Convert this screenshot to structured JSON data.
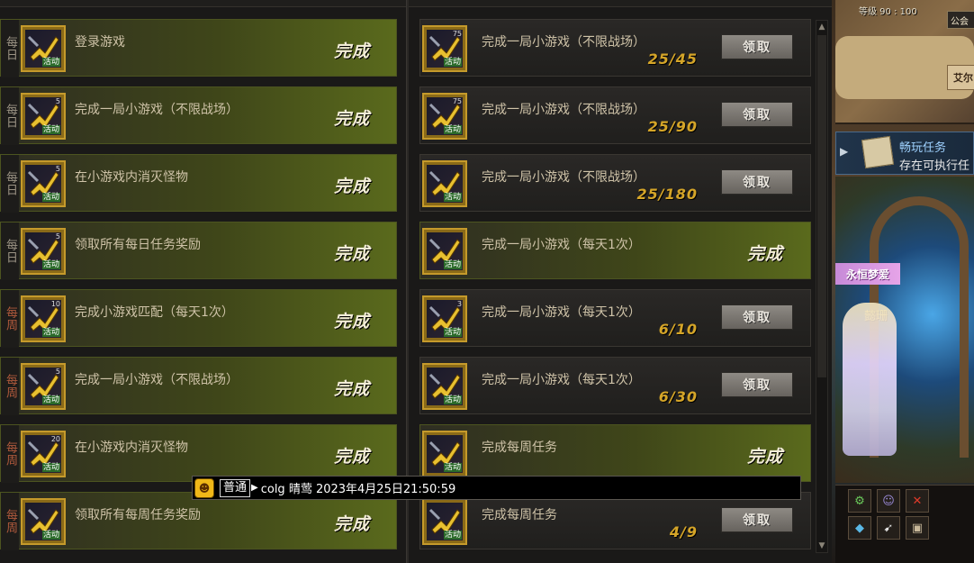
{
  "left_rows": [
    {
      "tag": "每日",
      "tag_type": "daily",
      "title": "登录游戏",
      "status": "完成",
      "icon_count": "",
      "icon_label": "活动"
    },
    {
      "tag": "每日",
      "tag_type": "daily",
      "title": "完成一局小游戏（不限战场）",
      "status": "完成",
      "icon_count": "5",
      "icon_label": "活动"
    },
    {
      "tag": "每日",
      "tag_type": "daily",
      "title": "在小游戏内消灭怪物",
      "status": "完成",
      "icon_count": "5",
      "icon_label": "活动"
    },
    {
      "tag": "每日",
      "tag_type": "daily",
      "title": "领取所有每日任务奖励",
      "status": "完成",
      "icon_count": "5",
      "icon_label": "活动"
    },
    {
      "tag": "每周",
      "tag_type": "weekly",
      "title": "完成小游戏匹配（每天1次）",
      "status": "完成",
      "icon_count": "10",
      "icon_label": "活动"
    },
    {
      "tag": "每周",
      "tag_type": "weekly",
      "title": "完成一局小游戏（不限战场）",
      "status": "完成",
      "icon_count": "5",
      "icon_label": "活动"
    },
    {
      "tag": "每周",
      "tag_type": "weekly",
      "title": "在小游戏内消灭怪物",
      "status": "完成",
      "icon_count": "20",
      "icon_label": "活动"
    },
    {
      "tag": "每周",
      "tag_type": "weekly",
      "title": "领取所有每周任务奖励",
      "status": "完成",
      "icon_count": "",
      "icon_label": "活动"
    }
  ],
  "right_rows": [
    {
      "title": "完成一局小游戏（不限战场）",
      "state": "claim",
      "progress": "25/45",
      "button": "领取",
      "icon_count": "75",
      "icon_label": "活动"
    },
    {
      "title": "完成一局小游戏（不限战场）",
      "state": "claim",
      "progress": "25/90",
      "button": "领取",
      "icon_count": "75",
      "icon_label": "活动"
    },
    {
      "title": "完成一局小游戏（不限战场）",
      "state": "claim",
      "progress": "25/180",
      "button": "领取",
      "icon_count": "",
      "icon_label": "活动"
    },
    {
      "title": "完成一局小游戏（每天1次）",
      "state": "done",
      "status": "完成",
      "icon_count": "",
      "icon_label": "活动"
    },
    {
      "title": "完成一局小游戏（每天1次）",
      "state": "claim",
      "progress": "6/10",
      "button": "领取",
      "icon_count": "3",
      "icon_label": "活动"
    },
    {
      "title": "完成一局小游戏（每天1次）",
      "state": "claim",
      "progress": "6/30",
      "button": "领取",
      "icon_count": "",
      "icon_label": "活动"
    },
    {
      "title": "完成每周任务",
      "state": "done",
      "status": "完成",
      "icon_count": "",
      "icon_label": "活动"
    },
    {
      "title": "完成每周任务",
      "state": "claim",
      "progress": "4/9",
      "button": "领取",
      "icon_count": "",
      "icon_label": "活动"
    }
  ],
  "chat": {
    "channel": "普通",
    "message": "colg 晴莺  2023年4月25日21:50:59"
  },
  "game_hud": {
    "level_text": "等级 90 : 100",
    "guild_button": "公会",
    "town_label": "艾尔",
    "quest_title": "畅玩任务",
    "quest_subtitle": "存在可执行任",
    "character_banner": "永恒梦爱",
    "character_name": "懿珊",
    "skill_icons": [
      "gear-icon",
      "cross-icon"
    ]
  },
  "colors": {
    "done_accent": "#5a6a1c",
    "progress_gold": "#d5a528",
    "weekly_tag": "#b05a3c"
  }
}
